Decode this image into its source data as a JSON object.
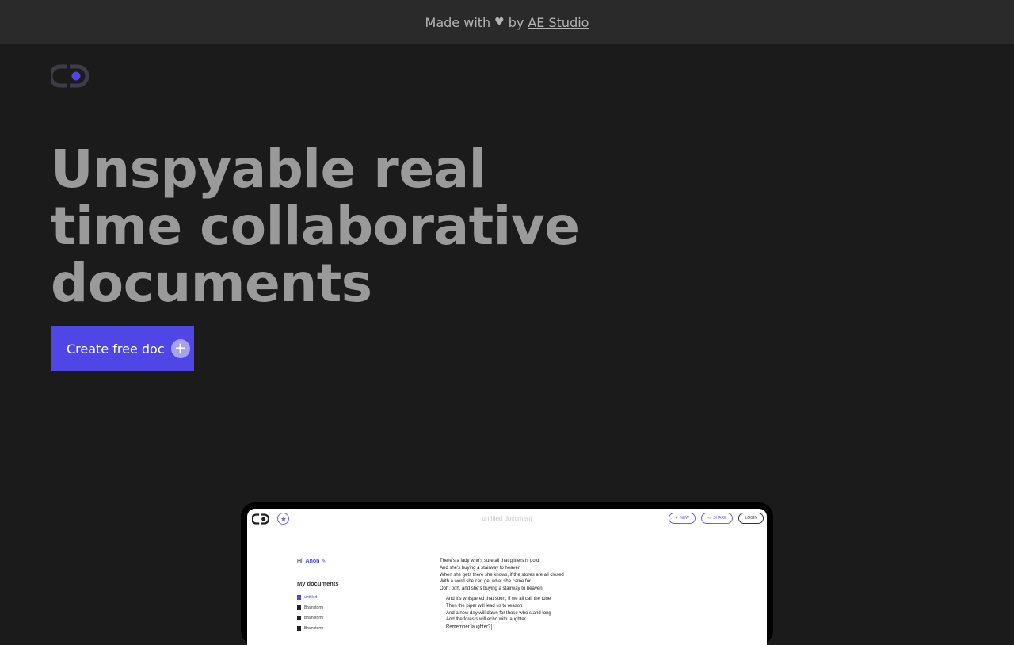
{
  "banner": {
    "prefix": "Made with",
    "heart": "♥",
    "by": "by",
    "link": "AE Studio"
  },
  "hero": {
    "line1": "Unspyable real",
    "line2": "time collaborative",
    "line3": "documents",
    "cta_label": "Create free doc",
    "cta_icon": "+"
  },
  "colors": {
    "accent": "#4f46e5",
    "background": "#1b1b1b",
    "banner_bg": "#2a2a2a",
    "headline": "#9a9a9a"
  },
  "preview": {
    "doc_title": "untitled document",
    "buttons": {
      "new": "NEW",
      "share": "SHARE",
      "login": "LOGIN"
    },
    "greeting": "Hi,",
    "user": "Anon",
    "my_documents": "My documents",
    "docs": [
      "untitled",
      "Brainstorm",
      "Brainstorm",
      "Brainstorm"
    ],
    "lines": [
      "There's a lady who's sure all that glitters is gold",
      "And she's buying a stairway to heaven",
      "When she gets there she knows, if the stores are all closed",
      "With a word she can get what she came for",
      "Ooh, ooh, and she's buying a stairway to heaven"
    ],
    "indented_lines": [
      "And it's whispered that soon, if we all call the tune",
      "Then the piper will lead us to reason",
      "And a new day will dawn for those who stand long",
      "And the forests will echo with laughter",
      "Remember laughter?"
    ]
  }
}
